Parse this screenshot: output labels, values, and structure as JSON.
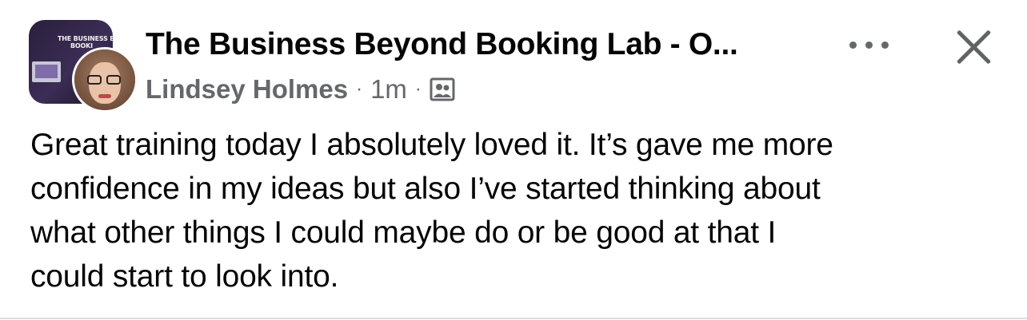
{
  "post": {
    "group_name": "The Business Beyond Booking Lab - O...",
    "group_thumb_text_line1": "THE BUSINESS BEYO",
    "group_thumb_text_line2": "BOOKI",
    "author": "Lindsey Holmes",
    "time": "1m",
    "separator": "·",
    "audience_icon": "group-audience-icon",
    "more_icon": "more-options-icon",
    "close_icon": "close-icon",
    "body_lines": [
      "Great training today I absolutely loved it. It’s gave me more",
      "confidence in my ideas but also I’ve started thinking about",
      "what other things I could maybe do or be good at that I",
      "could start to look into."
    ]
  },
  "colors": {
    "text_primary": "#050505",
    "text_secondary": "#65676b",
    "background": "#ffffff"
  }
}
